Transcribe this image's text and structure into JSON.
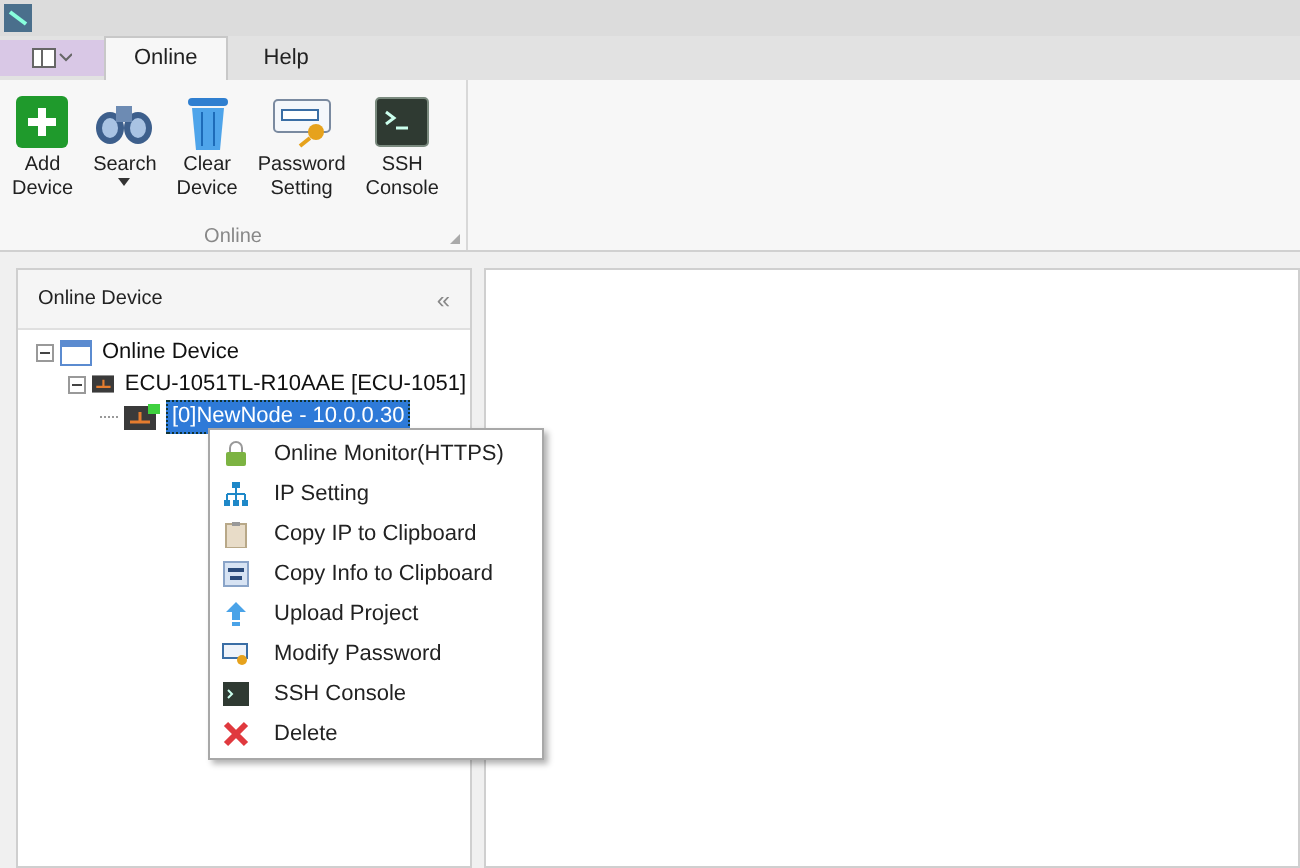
{
  "tabs": [
    {
      "label": "Online",
      "selected": true
    },
    {
      "label": "Help",
      "selected": false
    }
  ],
  "ribbon": {
    "buttons": [
      {
        "kind": "add",
        "label": "Add\nDevice"
      },
      {
        "kind": "search",
        "label": "Search",
        "dropdown": true
      },
      {
        "kind": "trash",
        "label": "Clear\nDevice"
      },
      {
        "kind": "password",
        "label": "Password\nSetting"
      },
      {
        "kind": "console",
        "label": "SSH\nConsole"
      }
    ],
    "group": "Online"
  },
  "panel": {
    "title": "Online Device",
    "collapse": "«"
  },
  "tree": [
    {
      "label": "Online Device",
      "kind": "root",
      "expanded": true,
      "selected": false,
      "children": [
        {
          "label": "ECU-1051TL-R10AAE [ECU-1051]",
          "kind": "device",
          "expanded": true,
          "selected": false,
          "children": [
            {
              "label": "[0]NewNode - 10.0.0.30",
              "kind": "node",
              "selected": true
            }
          ]
        }
      ]
    }
  ],
  "context_menu": [
    {
      "kind": "lock",
      "label": "Online Monitor(HTTPS)"
    },
    {
      "kind": "network",
      "label": "IP Setting"
    },
    {
      "kind": "clipboard",
      "label": "Copy IP to Clipboard"
    },
    {
      "kind": "info",
      "label": "Copy Info to Clipboard"
    },
    {
      "kind": "upload",
      "label": "Upload Project"
    },
    {
      "kind": "password",
      "label": "Modify Password"
    },
    {
      "kind": "console",
      "label": "SSH Console"
    },
    {
      "kind": "delete",
      "label": "Delete"
    }
  ]
}
